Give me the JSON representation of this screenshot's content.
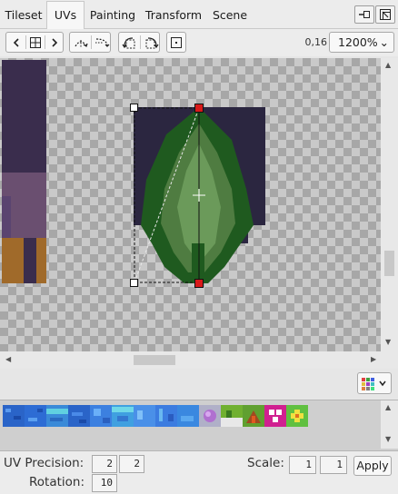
{
  "tabs": [
    {
      "label": "Tileset",
      "active": false
    },
    {
      "label": "UVs",
      "active": true
    },
    {
      "label": "Painting",
      "active": false
    },
    {
      "label": "Transform",
      "active": false
    },
    {
      "label": "Scene",
      "active": false
    }
  ],
  "window_buttons": [
    "undock-icon",
    "maximize-icon"
  ],
  "toolbar": {
    "uv_readout": "0,16",
    "zoom_value": "1200%",
    "zoom_caret": "⌄"
  },
  "bottom": {
    "uv_precision_label": "UV Precision:",
    "uv_precision_x": "2",
    "uv_precision_y": "2",
    "rotation_label": "Rotation:",
    "rotation_value": "10",
    "scale_label": "Scale:",
    "scale_x": "1",
    "scale_y": "1",
    "apply_label": "Apply"
  },
  "colors": {
    "accent_handle": "#d81a1a",
    "tree_dark": "#1f5a1f",
    "tree_light": "#5e8a4e",
    "background_tile": "#2b2640"
  }
}
